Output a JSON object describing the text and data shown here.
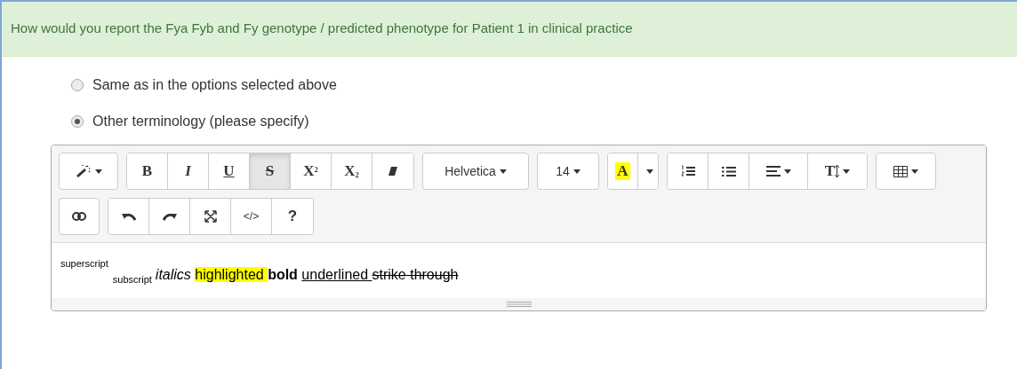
{
  "question": {
    "title": "How would you report the Fya Fyb and Fy genotype / predicted phenotype for Patient 1 in clinical practice"
  },
  "options": [
    {
      "label": "Same as in the options selected above",
      "selected": false
    },
    {
      "label": "Other terminology (please specify)",
      "selected": true
    }
  ],
  "toolbar": {
    "rows": [
      [
        [
          {
            "kind": "style",
            "selected": false
          }
        ],
        [
          {
            "kind": "bold",
            "label": "B",
            "selected": false
          },
          {
            "kind": "italic",
            "label": "I",
            "selected": false
          },
          {
            "kind": "underline",
            "label": "U",
            "selected": false
          },
          {
            "kind": "strikethrough",
            "label": "S",
            "selected": true
          },
          {
            "kind": "superscript",
            "label": "X$^{2}$",
            "selected": false
          },
          {
            "kind": "subscript",
            "label": "X$_{2}$",
            "selected": false
          },
          {
            "kind": "clear",
            "selected": false
          }
        ],
        [
          {
            "kind": "font",
            "label": "Helvetica",
            "selected": false
          }
        ],
        [
          {
            "kind": "size",
            "label": "14",
            "selected": false
          }
        ],
        [
          {
            "kind": "color",
            "label": "A",
            "selected": false
          },
          {
            "kind": "color-menu",
            "selected": false
          }
        ],
        [
          {
            "kind": "ol",
            "selected": false
          },
          {
            "kind": "ul",
            "selected": false
          },
          {
            "kind": "align",
            "selected": false
          },
          {
            "kind": "height",
            "label": "T",
            "selected": false
          }
        ],
        [
          {
            "kind": "table",
            "selected": false
          }
        ]
      ],
      [
        [
          {
            "kind": "link",
            "selected": false
          }
        ],
        [
          {
            "kind": "undo",
            "selected": false
          },
          {
            "kind": "redo",
            "selected": false
          },
          {
            "kind": "fullscreen",
            "selected": false
          },
          {
            "kind": "code",
            "label": "</>",
            "selected": false
          },
          {
            "kind": "help",
            "label": "?",
            "selected": false
          }
        ]
      ]
    ]
  },
  "editor": {
    "content": [
      {
        "kind": "superscript",
        "text": "superscript"
      },
      {
        "kind": "subscript",
        "text": "subscript"
      },
      {
        "kind": "italic",
        "text": "italics "
      },
      {
        "kind": "highlight",
        "text": "highlighted "
      },
      {
        "kind": "bold",
        "text": "bold "
      },
      {
        "kind": "underline",
        "text": "underlined "
      },
      {
        "kind": "strike",
        "text": "strike through"
      }
    ]
  }
}
